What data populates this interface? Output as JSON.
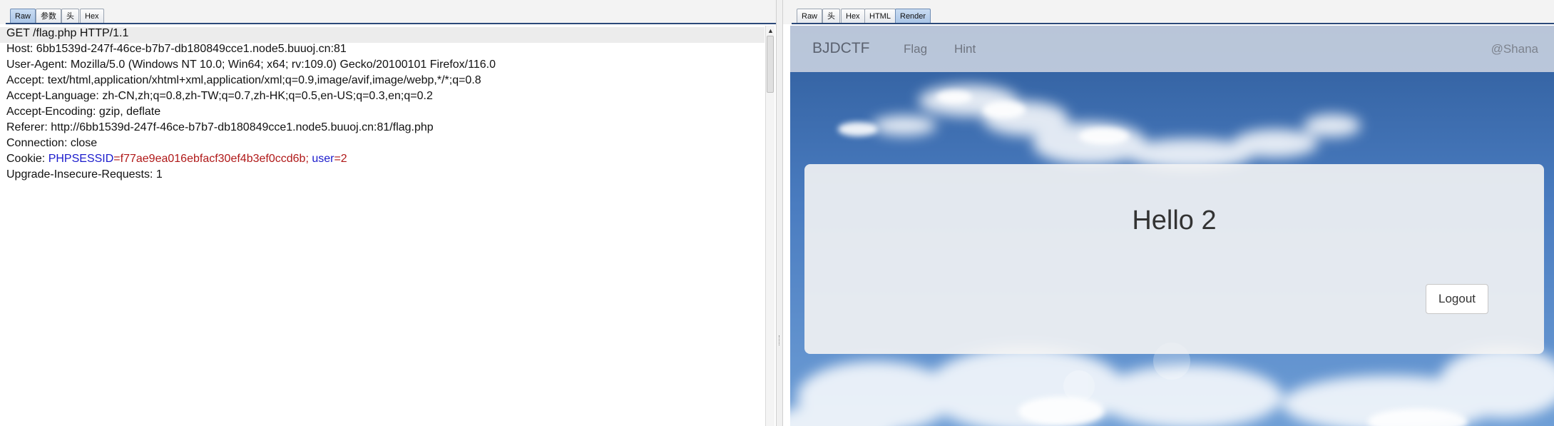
{
  "request_pane": {
    "tabs": [
      "Raw",
      "参数",
      "头",
      "Hex"
    ],
    "active_tab": "Raw",
    "lines": [
      "GET /flag.php HTTP/1.1",
      "Host: 6bb1539d-247f-46ce-b7b7-db180849cce1.node5.buuoj.cn:81",
      "User-Agent: Mozilla/5.0 (Windows NT 10.0; Win64; x64; rv:109.0) Gecko/20100101 Firefox/116.0",
      "Accept: text/html,application/xhtml+xml,application/xml;q=0.9,image/avif,image/webp,*/*;q=0.8",
      "Accept-Language: zh-CN,zh;q=0.8,zh-TW;q=0.7,zh-HK;q=0.5,en-US;q=0.3,en;q=0.2",
      "Accept-Encoding: gzip, deflate",
      "Referer: http://6bb1539d-247f-46ce-b7b7-db180849cce1.node5.buuoj.cn:81/flag.php",
      "Connection: close"
    ],
    "cookie": {
      "prefix": "Cookie: ",
      "name1": "PHPSESSID",
      "eq1": "=",
      "value1": "f77ae9ea016ebfacf30ef4b3ef0ccd6b",
      "sep": "; ",
      "name2": "user",
      "eq2": "=",
      "value2": "2"
    },
    "last_line": "Upgrade-Insecure-Requests: 1",
    "scroll_arrow": "▲"
  },
  "response_pane": {
    "tabs": [
      "Raw",
      "头",
      "Hex",
      "HTML",
      "Render"
    ],
    "active_tab": "Render",
    "navbar": {
      "brand": "BJDCTF",
      "links": [
        "Flag",
        "Hint"
      ],
      "user": "@Shana"
    },
    "card": {
      "greeting": "Hello 2",
      "logout_label": "Logout"
    }
  },
  "colors": {
    "header_name": "#1a1acc",
    "header_value": "#b01818",
    "tab_rule": "#2c4a7a",
    "sky_top": "#2f5d9c"
  }
}
